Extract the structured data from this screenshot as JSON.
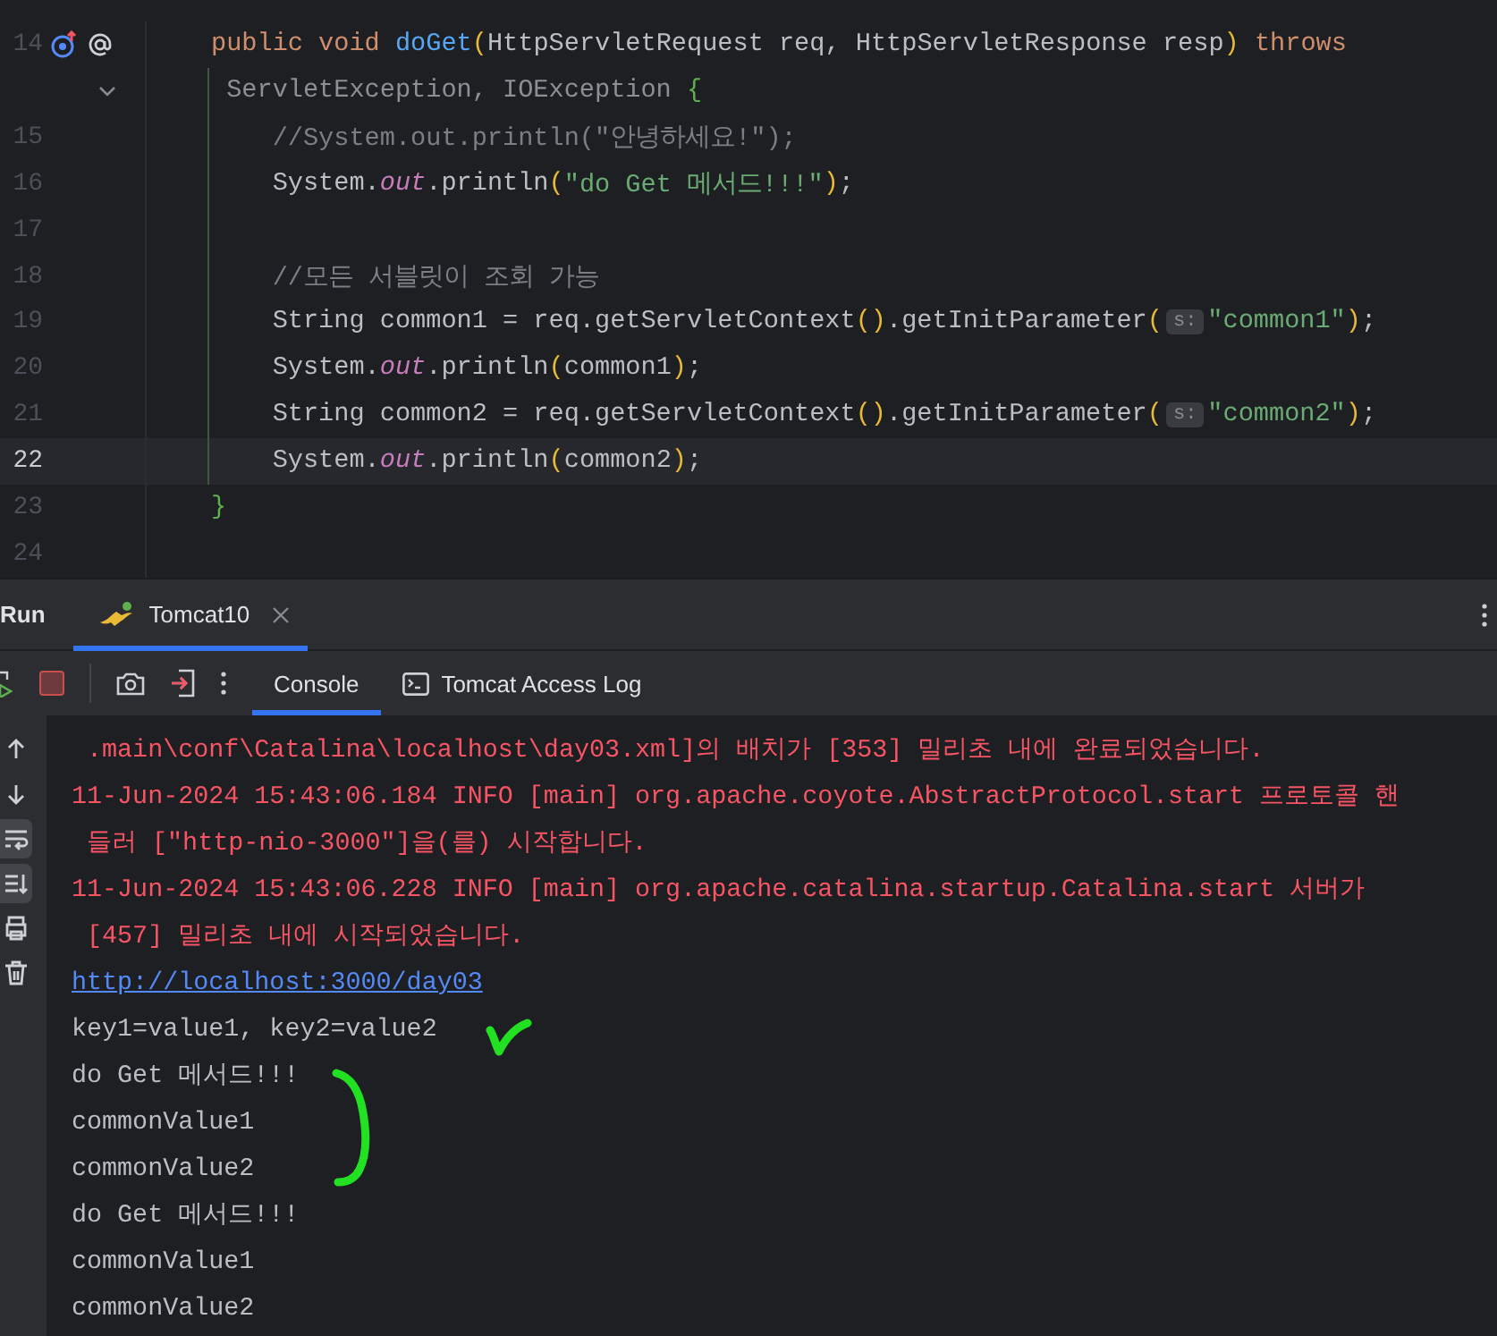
{
  "editor": {
    "lines": [
      {
        "number": "14",
        "current": false,
        "gutter_icons": true,
        "segments": [
          {
            "kind": "keyword",
            "text": "public void "
          },
          {
            "kind": "method",
            "text": "doGet"
          },
          {
            "kind": "paren",
            "text": "("
          },
          {
            "kind": "plain",
            "text": "HttpServletRequest req, HttpServletResponse resp"
          },
          {
            "kind": "paren",
            "text": ")"
          },
          {
            "kind": "keyword",
            "text": " throws"
          }
        ]
      },
      {
        "current": false,
        "fold": true,
        "segments": [
          {
            "kind": "dim",
            "text": " ServletException, IOException "
          },
          {
            "kind": "brace",
            "text": "{"
          }
        ]
      },
      {
        "number": "15",
        "current": false,
        "segments": [
          {
            "kind": "comment",
            "text": "    //System.out.println(\"안녕하세요!\");"
          }
        ]
      },
      {
        "number": "16",
        "current": false,
        "segments": [
          {
            "kind": "plain",
            "text": "    System."
          },
          {
            "kind": "field",
            "text": "out"
          },
          {
            "kind": "plain",
            "text": ".println"
          },
          {
            "kind": "paren",
            "text": "("
          },
          {
            "kind": "string",
            "text": "\"do Get 메서드!!!\""
          },
          {
            "kind": "paren",
            "text": ")"
          },
          {
            "kind": "plain",
            "text": ";"
          }
        ]
      },
      {
        "number": "17",
        "current": false
      },
      {
        "number": "18",
        "current": false,
        "segments": [
          {
            "kind": "comment",
            "text": "    //모든 서블릿이 조회 가능"
          }
        ]
      },
      {
        "number": "19",
        "current": false,
        "segments": [
          {
            "kind": "plain",
            "text": "    String common1 = req.getServletContext"
          },
          {
            "kind": "paren",
            "text": "()"
          },
          {
            "kind": "plain",
            "text": ".getInitParameter"
          },
          {
            "kind": "paren",
            "text": "("
          },
          {
            "kind": "hint",
            "text": "s:"
          },
          {
            "kind": "string",
            "text": "\"common1\""
          },
          {
            "kind": "paren",
            "text": ")"
          },
          {
            "kind": "plain",
            "text": ";"
          }
        ]
      },
      {
        "number": "20",
        "current": false,
        "segments": [
          {
            "kind": "plain",
            "text": "    System."
          },
          {
            "kind": "field",
            "text": "out"
          },
          {
            "kind": "plain",
            "text": ".println"
          },
          {
            "kind": "paren",
            "text": "("
          },
          {
            "kind": "plain",
            "text": "common1"
          },
          {
            "kind": "paren",
            "text": ")"
          },
          {
            "kind": "plain",
            "text": ";"
          }
        ]
      },
      {
        "number": "21",
        "current": false,
        "segments": [
          {
            "kind": "plain",
            "text": "    String common2 = req.getServletContext"
          },
          {
            "kind": "paren",
            "text": "()"
          },
          {
            "kind": "plain",
            "text": ".getInitParameter"
          },
          {
            "kind": "paren",
            "text": "("
          },
          {
            "kind": "hint",
            "text": "s:"
          },
          {
            "kind": "string",
            "text": "\"common2\""
          },
          {
            "kind": "paren",
            "text": ")"
          },
          {
            "kind": "plain",
            "text": ";"
          }
        ]
      },
      {
        "number": "22",
        "current": true,
        "segments": [
          {
            "kind": "plain",
            "text": "    System."
          },
          {
            "kind": "field",
            "text": "out"
          },
          {
            "kind": "plain",
            "text": ".println"
          },
          {
            "kind": "paren",
            "text": "("
          },
          {
            "kind": "plain",
            "text": "common2"
          },
          {
            "kind": "paren",
            "text": ")"
          },
          {
            "kind": "plain",
            "text": ";"
          }
        ]
      },
      {
        "number": "23",
        "current": false,
        "segments": [
          {
            "kind": "brace",
            "text": "}"
          }
        ]
      },
      {
        "number": "24",
        "current": false
      }
    ]
  },
  "run": {
    "title": "Run",
    "tabs": [
      {
        "label": "Tomcat10",
        "selected": true
      }
    ],
    "console_tabs": [
      {
        "label": "Console",
        "selected": true,
        "kind": "plain"
      },
      {
        "label": "Tomcat Access Log",
        "selected": false,
        "kind": "terminal"
      }
    ],
    "side_tools": [
      {
        "kind": "up",
        "selected": false
      },
      {
        "kind": "down",
        "selected": false
      },
      {
        "kind": "wrap",
        "selected": true
      },
      {
        "kind": "scroll",
        "selected": true
      },
      {
        "kind": "print",
        "selected": false
      },
      {
        "kind": "trash",
        "selected": false
      }
    ],
    "console": [
      {
        "kind": "error",
        "text": " .main\\conf\\Catalina\\localhost\\day03.xml]의 배치가 [353] 밀리초 내에 완료되었습니다."
      },
      {
        "kind": "error",
        "text": "11-Jun-2024 15:43:06.184 INFO [main] org.apache.coyote.AbstractProtocol.start 프로토콜 핸"
      },
      {
        "kind": "error",
        "text": " 들러 [\"http-nio-3000\"]을(를) 시작합니다."
      },
      {
        "kind": "error",
        "text": "11-Jun-2024 15:43:06.228 INFO [main] org.apache.catalina.startup.Catalina.start 서버가"
      },
      {
        "kind": "error",
        "text": " [457] 밀리초 내에 시작되었습니다."
      },
      {
        "kind": "link",
        "text": "http://localhost:3000/day03"
      },
      {
        "kind": "plain",
        "text": "key1=value1, key2=value2"
      },
      {
        "kind": "plain",
        "text": "do Get 메서드!!!"
      },
      {
        "kind": "plain",
        "text": "commonValue1"
      },
      {
        "kind": "plain",
        "text": "commonValue2"
      },
      {
        "kind": "plain",
        "text": "do Get 메서드!!!"
      },
      {
        "kind": "plain",
        "text": "commonValue1"
      },
      {
        "kind": "plain",
        "text": "commonValue2"
      }
    ]
  }
}
